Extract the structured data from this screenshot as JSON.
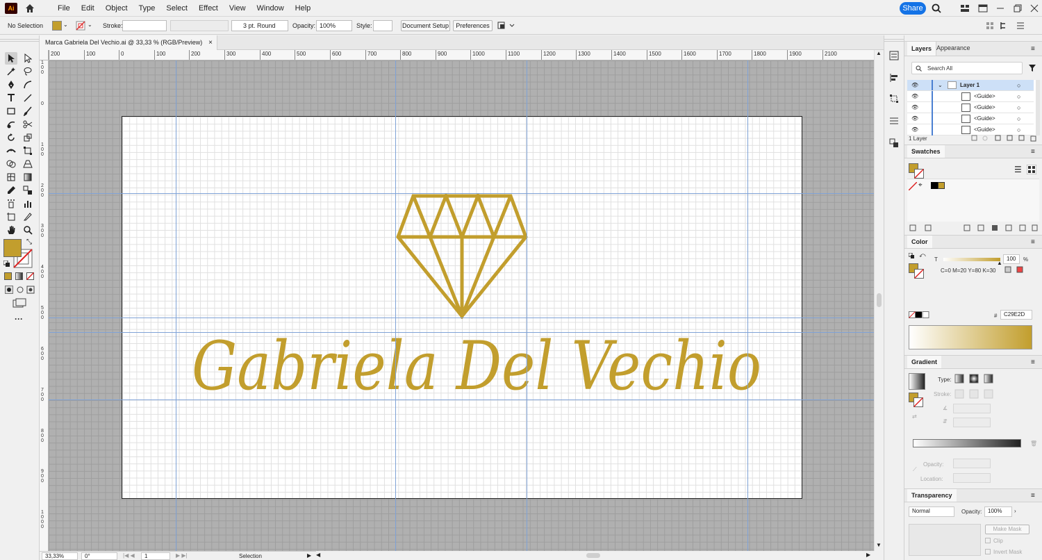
{
  "app": {
    "logo_text": "Ai",
    "menu": [
      "File",
      "Edit",
      "Object",
      "Type",
      "Select",
      "Effect",
      "View",
      "Window",
      "Help"
    ],
    "share_label": "Share"
  },
  "controlbar": {
    "selection_label": "No Selection",
    "stroke_label": "Stroke:",
    "brush_value": "3 pt. Round",
    "opacity_label": "Opacity:",
    "opacity_value": "100%",
    "style_label": "Style:",
    "document_setup_label": "Document Setup",
    "preferences_label": "Preferences"
  },
  "document": {
    "tab_title": "Marca Gabriela Del Vechio.ai @ 33,33 % (RGB/Preview)",
    "close_glyph": "×",
    "artwork_text": "Gabriela Del Vechio",
    "ruler_labels": [
      "200",
      "100",
      "0",
      "100",
      "200",
      "300",
      "400",
      "500",
      "600",
      "700",
      "800",
      "900",
      "1000",
      "1100",
      "1200",
      "1300",
      "1400",
      "1500",
      "1600",
      "1700",
      "1800",
      "1900",
      "2100"
    ],
    "vruler_labels": [
      "1\n0\n0",
      "0",
      "1\n0\n0",
      "2\n0\n0",
      "3\n0\n0",
      "4\n0\n0",
      "5\n0\n0",
      "6\n0\n0",
      "7\n0\n0",
      "8\n0\n0",
      "9\n0\n0",
      "1\n0\n0\n0"
    ]
  },
  "status": {
    "zoom": "33,33%",
    "rotation": "0°",
    "artboard_num": "1",
    "tool": "Selection"
  },
  "layers_panel": {
    "tab_layers": "Layers",
    "tab_appearance": "Appearance",
    "search_placeholder": "Search All",
    "rows": [
      {
        "label": "Layer 1"
      },
      {
        "label": "<Guide>"
      },
      {
        "label": "<Guide>"
      },
      {
        "label": "<Guide>"
      },
      {
        "label": "<Guide>"
      }
    ],
    "footer": "1 Layer"
  },
  "swatches_panel": {
    "title": "Swatches"
  },
  "color_panel": {
    "title": "Color",
    "channel_label": "T",
    "tint_value": "100",
    "percent": "%",
    "cmyk_text": "C=0 M=20 Y=80 K=30",
    "hash": "#",
    "hex_value": "C29E2D"
  },
  "gradient_panel": {
    "title": "Gradient",
    "type_label": "Type:",
    "stroke_label": "Stroke:",
    "opacity_label": "Opacity:",
    "location_label": "Location:"
  },
  "transparency_panel": {
    "title": "Transparency",
    "blend_mode": "Normal",
    "opacity_label": "Opacity:",
    "opacity_value": "100%",
    "make_mask": "Make Mask",
    "clip": "Clip",
    "invert_mask": "Invert Mask"
  },
  "colors": {
    "fill": "#C29E2D",
    "accent": "#1473e6",
    "guide": "#7fa2d6"
  }
}
